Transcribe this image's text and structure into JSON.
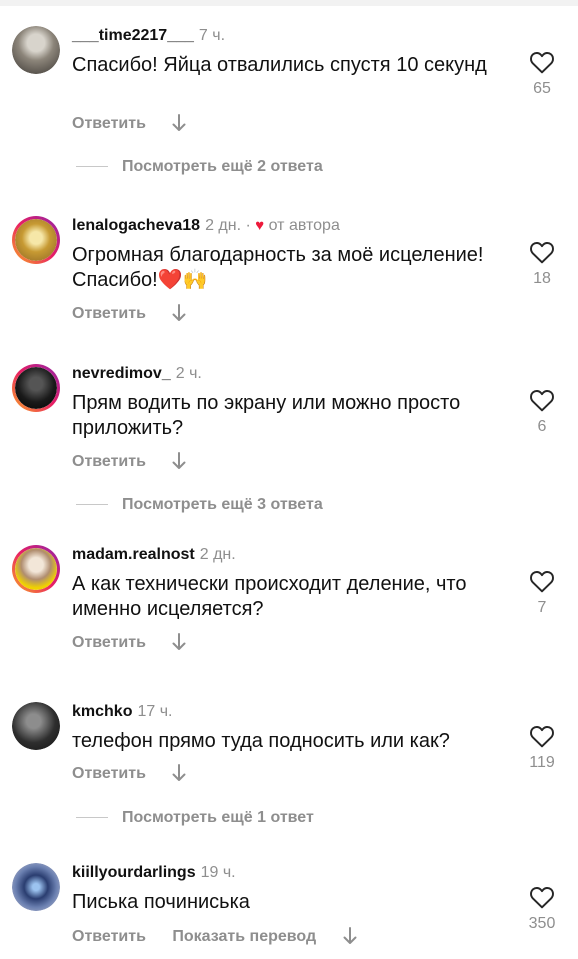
{
  "comments": [
    {
      "username": "___time2217___",
      "time": "7 ч.",
      "text": "Спасибо! Яйца отвалились спустя 10 секунд",
      "likes": "65",
      "reply_label": "Ответить",
      "replies_label": "Посмотреть ещё 2 ответа"
    },
    {
      "username": "lenalogacheva18",
      "time": "2 дн. ·",
      "author_label": "от автора",
      "text": "Огромная благодарность за моё исцеление! Спасибо!",
      "emoji": "❤️🙌",
      "likes": "18",
      "reply_label": "Ответить"
    },
    {
      "username": "nevredimov_",
      "time": "2 ч.",
      "text": "Прям водить по экрану или можно просто приложить?",
      "likes": "6",
      "reply_label": "Ответить",
      "replies_label": "Посмотреть ещё 3 ответа"
    },
    {
      "username": "madam.realnost",
      "time": "2 дн.",
      "text": "А как технически происходит деление, что именно исцеляется?",
      "likes": "7",
      "reply_label": "Ответить"
    },
    {
      "username": "kmchko",
      "time": "17 ч.",
      "text": "телефон прямо туда подносить или как?",
      "likes": "119",
      "reply_label": "Ответить",
      "replies_label": "Посмотреть ещё 1 ответ"
    },
    {
      "username": "kiillyourdarlings",
      "time": "19 ч.",
      "text": "Писька починиська",
      "likes": "350",
      "reply_label": "Ответить",
      "translate_label": "Показать перевод"
    }
  ],
  "icons": {
    "like": "heart-outline-icon",
    "more": "down-arrow-icon"
  },
  "colors": {
    "text": "#111111",
    "secondary": "#8e8e8e",
    "heart": "#ed1a3b"
  }
}
